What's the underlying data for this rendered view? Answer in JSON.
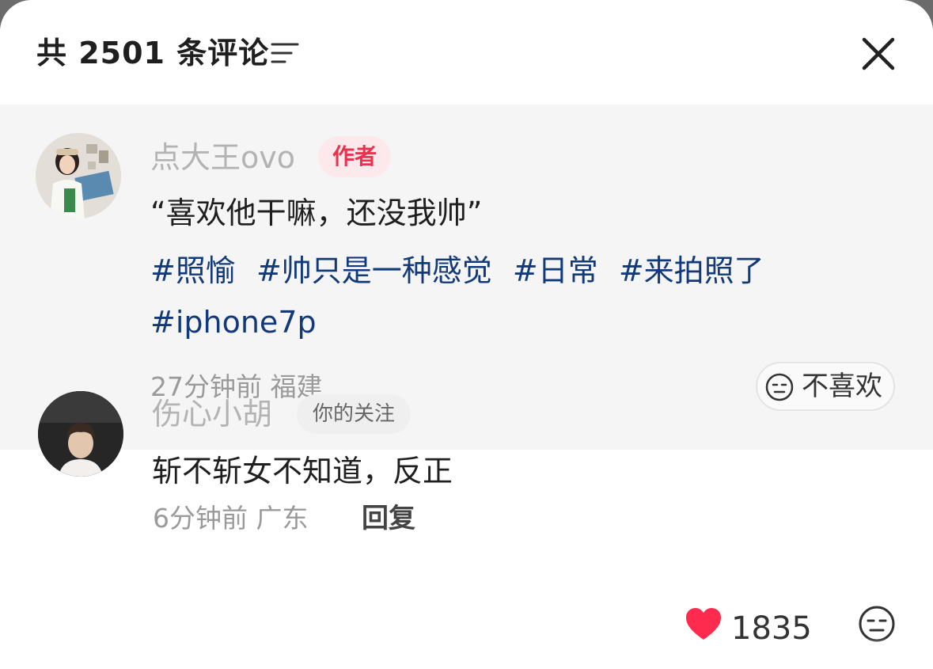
{
  "header": {
    "title": "共 2501 条评论",
    "sort_icon": "sort-lines-icon",
    "close_icon": "close-icon"
  },
  "comments": [
    {
      "username": "点大王ovo",
      "badge": "作者",
      "text": "“喜欢他干嘛，还没我帅”",
      "tags": [
        "#照愉",
        "#帅只是一种感觉",
        "#日常",
        "#来拍照了",
        "#iphone7p"
      ],
      "time": "27分钟前",
      "location": "福建",
      "dislike_label": "不喜欢"
    },
    {
      "username": "伤心小胡",
      "badge": "你的关注",
      "text": "斩不斩女不知道，反正",
      "time": "6分钟前",
      "location": "广东",
      "reply_label": "回复",
      "like_count": "1835"
    }
  ],
  "colors": {
    "author_badge_text": "#e8334e",
    "author_badge_bg": "#fde9ec",
    "hashtag": "#123a7a",
    "like_heart": "#ff2b4f",
    "highlight_bg": "#f5f5f5"
  }
}
